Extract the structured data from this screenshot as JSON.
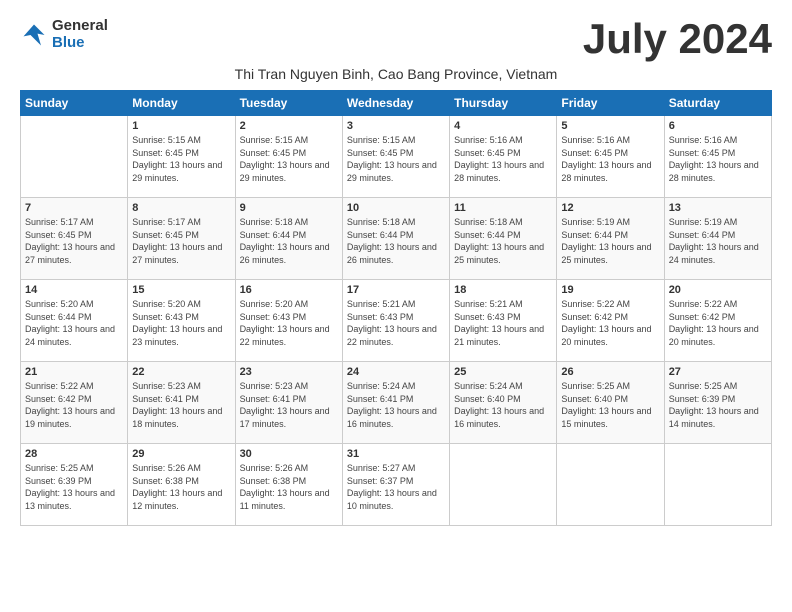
{
  "logo": {
    "general": "General",
    "blue": "Blue"
  },
  "title": "July 2024",
  "subtitle": "Thi Tran Nguyen Binh, Cao Bang Province, Vietnam",
  "days_of_week": [
    "Sunday",
    "Monday",
    "Tuesday",
    "Wednesday",
    "Thursday",
    "Friday",
    "Saturday"
  ],
  "weeks": [
    [
      {
        "day": "",
        "text": ""
      },
      {
        "day": "1",
        "text": "Sunrise: 5:15 AM\nSunset: 6:45 PM\nDaylight: 13 hours\nand 29 minutes."
      },
      {
        "day": "2",
        "text": "Sunrise: 5:15 AM\nSunset: 6:45 PM\nDaylight: 13 hours\nand 29 minutes."
      },
      {
        "day": "3",
        "text": "Sunrise: 5:15 AM\nSunset: 6:45 PM\nDaylight: 13 hours\nand 29 minutes."
      },
      {
        "day": "4",
        "text": "Sunrise: 5:16 AM\nSunset: 6:45 PM\nDaylight: 13 hours\nand 28 minutes."
      },
      {
        "day": "5",
        "text": "Sunrise: 5:16 AM\nSunset: 6:45 PM\nDaylight: 13 hours\nand 28 minutes."
      },
      {
        "day": "6",
        "text": "Sunrise: 5:16 AM\nSunset: 6:45 PM\nDaylight: 13 hours\nand 28 minutes."
      }
    ],
    [
      {
        "day": "7",
        "text": "Sunrise: 5:17 AM\nSunset: 6:45 PM\nDaylight: 13 hours\nand 27 minutes."
      },
      {
        "day": "8",
        "text": "Sunrise: 5:17 AM\nSunset: 6:45 PM\nDaylight: 13 hours\nand 27 minutes."
      },
      {
        "day": "9",
        "text": "Sunrise: 5:18 AM\nSunset: 6:44 PM\nDaylight: 13 hours\nand 26 minutes."
      },
      {
        "day": "10",
        "text": "Sunrise: 5:18 AM\nSunset: 6:44 PM\nDaylight: 13 hours\nand 26 minutes."
      },
      {
        "day": "11",
        "text": "Sunrise: 5:18 AM\nSunset: 6:44 PM\nDaylight: 13 hours\nand 25 minutes."
      },
      {
        "day": "12",
        "text": "Sunrise: 5:19 AM\nSunset: 6:44 PM\nDaylight: 13 hours\nand 25 minutes."
      },
      {
        "day": "13",
        "text": "Sunrise: 5:19 AM\nSunset: 6:44 PM\nDaylight: 13 hours\nand 24 minutes."
      }
    ],
    [
      {
        "day": "14",
        "text": "Sunrise: 5:20 AM\nSunset: 6:44 PM\nDaylight: 13 hours\nand 24 minutes."
      },
      {
        "day": "15",
        "text": "Sunrise: 5:20 AM\nSunset: 6:43 PM\nDaylight: 13 hours\nand 23 minutes."
      },
      {
        "day": "16",
        "text": "Sunrise: 5:20 AM\nSunset: 6:43 PM\nDaylight: 13 hours\nand 22 minutes."
      },
      {
        "day": "17",
        "text": "Sunrise: 5:21 AM\nSunset: 6:43 PM\nDaylight: 13 hours\nand 22 minutes."
      },
      {
        "day": "18",
        "text": "Sunrise: 5:21 AM\nSunset: 6:43 PM\nDaylight: 13 hours\nand 21 minutes."
      },
      {
        "day": "19",
        "text": "Sunrise: 5:22 AM\nSunset: 6:42 PM\nDaylight: 13 hours\nand 20 minutes."
      },
      {
        "day": "20",
        "text": "Sunrise: 5:22 AM\nSunset: 6:42 PM\nDaylight: 13 hours\nand 20 minutes."
      }
    ],
    [
      {
        "day": "21",
        "text": "Sunrise: 5:22 AM\nSunset: 6:42 PM\nDaylight: 13 hours\nand 19 minutes."
      },
      {
        "day": "22",
        "text": "Sunrise: 5:23 AM\nSunset: 6:41 PM\nDaylight: 13 hours\nand 18 minutes."
      },
      {
        "day": "23",
        "text": "Sunrise: 5:23 AM\nSunset: 6:41 PM\nDaylight: 13 hours\nand 17 minutes."
      },
      {
        "day": "24",
        "text": "Sunrise: 5:24 AM\nSunset: 6:41 PM\nDaylight: 13 hours\nand 16 minutes."
      },
      {
        "day": "25",
        "text": "Sunrise: 5:24 AM\nSunset: 6:40 PM\nDaylight: 13 hours\nand 16 minutes."
      },
      {
        "day": "26",
        "text": "Sunrise: 5:25 AM\nSunset: 6:40 PM\nDaylight: 13 hours\nand 15 minutes."
      },
      {
        "day": "27",
        "text": "Sunrise: 5:25 AM\nSunset: 6:39 PM\nDaylight: 13 hours\nand 14 minutes."
      }
    ],
    [
      {
        "day": "28",
        "text": "Sunrise: 5:25 AM\nSunset: 6:39 PM\nDaylight: 13 hours\nand 13 minutes."
      },
      {
        "day": "29",
        "text": "Sunrise: 5:26 AM\nSunset: 6:38 PM\nDaylight: 13 hours\nand 12 minutes."
      },
      {
        "day": "30",
        "text": "Sunrise: 5:26 AM\nSunset: 6:38 PM\nDaylight: 13 hours\nand 11 minutes."
      },
      {
        "day": "31",
        "text": "Sunrise: 5:27 AM\nSunset: 6:37 PM\nDaylight: 13 hours\nand 10 minutes."
      },
      {
        "day": "",
        "text": ""
      },
      {
        "day": "",
        "text": ""
      },
      {
        "day": "",
        "text": ""
      }
    ]
  ]
}
